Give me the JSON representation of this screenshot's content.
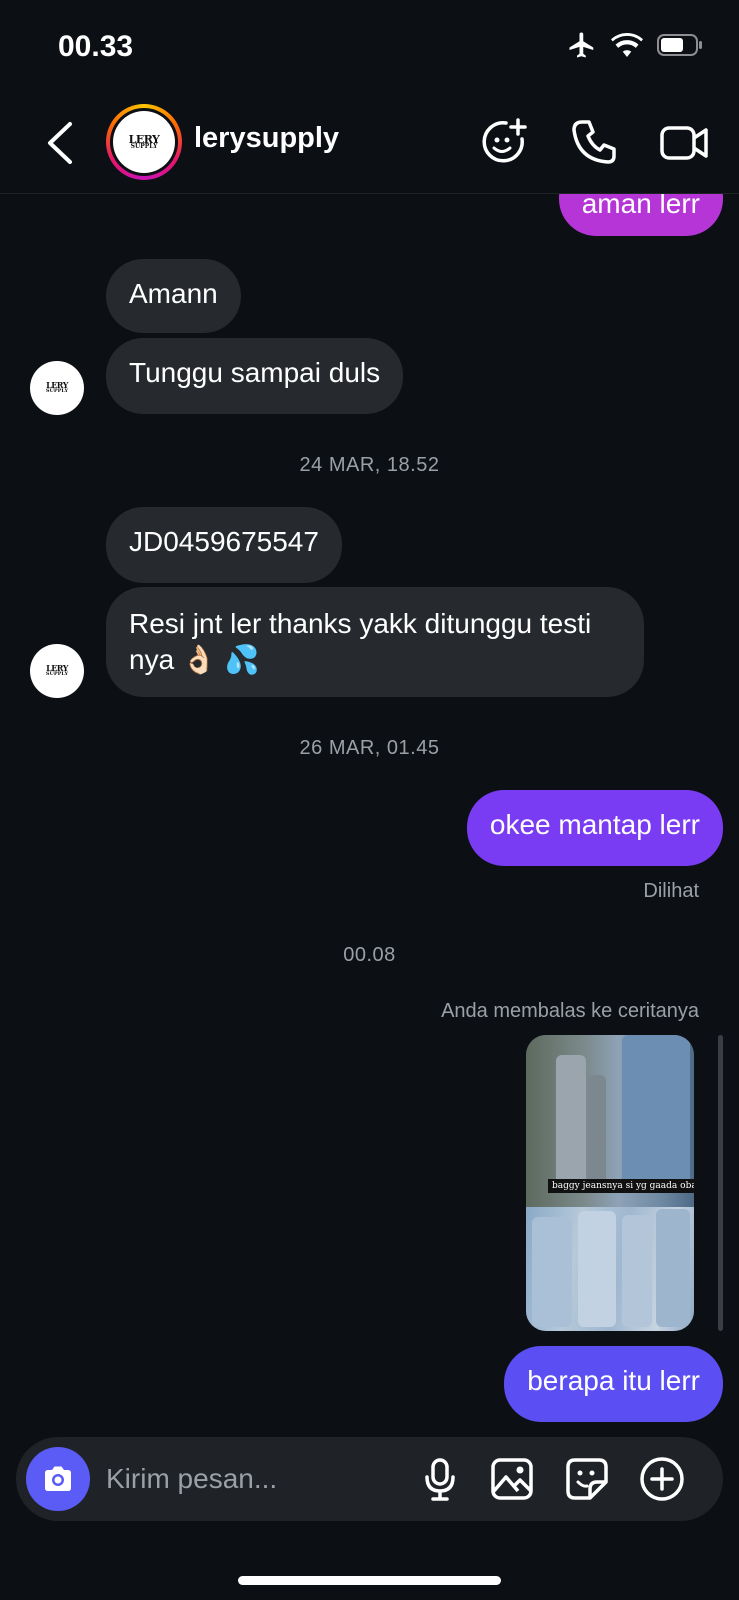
{
  "status": {
    "time": "00.33",
    "icons": [
      "airplane-icon",
      "wifi-icon",
      "battery-icon"
    ]
  },
  "header": {
    "username": "lerysupply",
    "avatar_logo_main": "LERY",
    "avatar_logo_sub": "SUPPLY"
  },
  "messages": [
    {
      "side": "out",
      "text": "aman lerr"
    },
    {
      "side": "in",
      "text": "Amann"
    },
    {
      "side": "in",
      "text": "Tunggu sampai duls"
    },
    {
      "type": "timestamp",
      "text": "24 MAR, 18.52"
    },
    {
      "side": "in",
      "text": "JD0459675547"
    },
    {
      "side": "in",
      "text": "Resi jnt ler thanks yakk ditunggu testi nya 👌🏻 💦"
    },
    {
      "type": "timestamp",
      "text": "26 MAR, 01.45"
    },
    {
      "side": "out",
      "text": "okee mantap lerr"
    },
    {
      "type": "seen",
      "text": "Dilihat"
    },
    {
      "type": "timestamp",
      "text": "00.08"
    },
    {
      "type": "reply_note",
      "text": "Anda membalas ke ceritanya"
    },
    {
      "type": "story",
      "caption": "baggy jeansnya si yg gaada obat💿"
    },
    {
      "side": "out",
      "text": "berapa itu lerr"
    }
  ],
  "composer": {
    "placeholder": "Kirim pesan..."
  },
  "colors": {
    "background": "#0c1014",
    "incoming": "#262a2f",
    "outgoing_top": "#b535d6",
    "outgoing_mid": "#7a3cf2",
    "outgoing_bottom": "#5b4ef2",
    "camera": "#5b5cf6"
  }
}
